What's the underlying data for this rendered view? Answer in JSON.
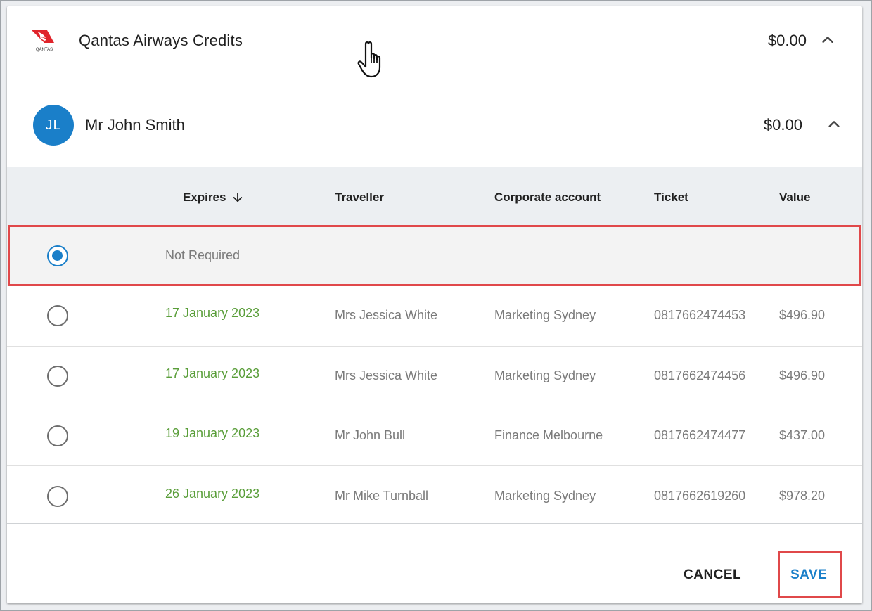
{
  "provider": {
    "logo_icon": "qantas-kangaroo-logo-icon",
    "logo_text": "QANTAS",
    "title": "Qantas Airways Credits",
    "amount": "$0.00"
  },
  "traveller": {
    "initials": "JL",
    "name": "Mr John Smith",
    "amount": "$0.00"
  },
  "table": {
    "headers": {
      "expires": "Expires",
      "traveller": "Traveller",
      "corporate_account": "Corporate account",
      "ticket": "Ticket",
      "value": "Value"
    },
    "not_required_label": "Not Required",
    "rows": [
      {
        "expires": "17 January 2023",
        "traveller": "Mrs Jessica White",
        "corporate_account": "Marketing Sydney",
        "ticket": "0817662474453",
        "value": "$496.90"
      },
      {
        "expires": "17 January 2023",
        "traveller": "Mrs Jessica White",
        "corporate_account": "Marketing Sydney",
        "ticket": "0817662474456",
        "value": "$496.90"
      },
      {
        "expires": "19 January 2023",
        "traveller": "Mr John Bull",
        "corporate_account": "Finance Melbourne",
        "ticket": "0817662474477",
        "value": "$437.00"
      },
      {
        "expires": "26 January 2023",
        "traveller": "Mr Mike Turnball",
        "corporate_account": "Marketing Sydney",
        "ticket": "0817662619260",
        "value": "$978.20"
      }
    ]
  },
  "footer": {
    "cancel_label": "CANCEL",
    "save_label": "SAVE"
  },
  "colors": {
    "accent": "#1a7fc9",
    "date_green": "#5a9e3a",
    "highlight_red": "#e0484a",
    "qantas_red": "#e0242b"
  }
}
